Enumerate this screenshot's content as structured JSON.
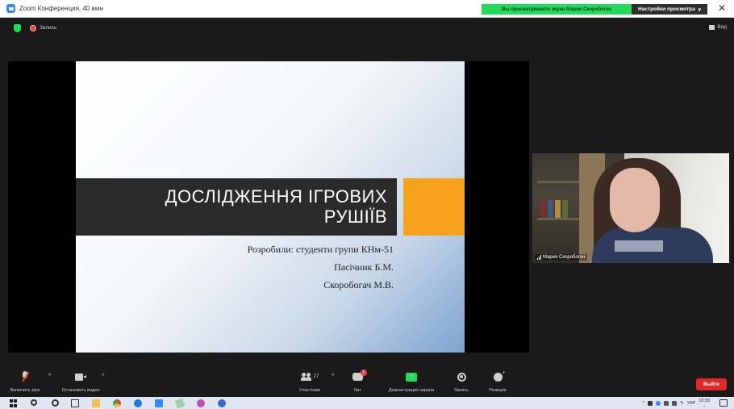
{
  "window": {
    "title": "Zoom Конференция, 40 мин",
    "close_glyph": "✕"
  },
  "banner": {
    "viewing_text": "Вы просматриваете экран Мария Скоробогач",
    "view_options_label": "Настройки просмотра",
    "view_options_caret": "▾",
    "accent_color": "#23d959"
  },
  "meeting_bar": {
    "recording_label": "Запись",
    "view_label": "Вид"
  },
  "slide": {
    "title_line1": "ДОСЛІДЖЕННЯ ІГРОВИХ",
    "title_line2": "РУШІЇВ",
    "subtitle_line1": "Розробили: студенти групи КНм-51",
    "subtitle_line2": "Пасічник Б.М.",
    "subtitle_line3": "Скоробогач М.В.",
    "accent_color": "#f6a21c"
  },
  "participant": {
    "name": "Мария Скоробогач"
  },
  "controls": {
    "unmute_label": "Включить звук",
    "stop_video_label": "Остановить видео",
    "participants_label": "Участники",
    "participants_count": "27",
    "chat_label": "Чат",
    "chat_badge": "1",
    "share_label": "Демонстрация экрана",
    "record_label": "Запись",
    "reactions_label": "Реакции",
    "leave_label": "Выйти",
    "caret": "^"
  },
  "taskbar": {
    "language": "УКР",
    "time": "10:33",
    "date": "..."
  },
  "icons": [
    "zoom-logo-icon",
    "security-shield-icon",
    "recording-dot-icon",
    "grid-view-icon",
    "mic-muted-icon",
    "camera-icon",
    "participants-icon",
    "chat-icon",
    "share-screen-icon",
    "record-icon",
    "reactions-icon",
    "windows-start-icon",
    "search-icon",
    "cortana-icon",
    "task-view-icon",
    "file-explorer-icon",
    "chrome-icon",
    "zoom-app-icon",
    "notepad-icon",
    "paint-icon",
    "notification-icon"
  ]
}
